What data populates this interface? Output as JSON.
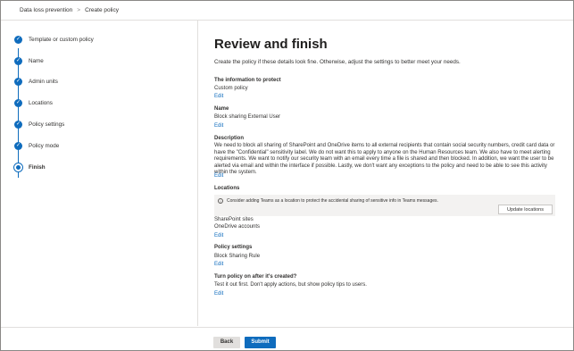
{
  "breadcrumb": {
    "items": [
      "Data loss prevention",
      "Create policy"
    ],
    "separator": ">"
  },
  "steps": [
    "Template or custom policy",
    "Name",
    "Admin units",
    "Locations",
    "Policy settings",
    "Policy mode",
    "Finish"
  ],
  "main": {
    "title": "Review and finish",
    "intro": "Create the policy if these details look fine. Otherwise, adjust the settings to better meet your needs.",
    "edit_label": "Edit",
    "info_protect": {
      "title": "The information to protect",
      "value": "Custom policy"
    },
    "name": {
      "title": "Name",
      "value": "Block sharing External User"
    },
    "description": {
      "title": "Description",
      "value": "We need to block all sharing of SharePoint and OneDrive items to all external recipients that contain social security numbers, credit card data or have the \"Confidential\" sensitivity label. We do not want this to apply to anyone on the Human Resources team. We also have to meet alerting requirements. We want to notify our security team with an email every time a file is shared and then blocked. In addition, we want the user to be alerted via email and within the interface if possible. Lastly, we don't want any exceptions to the policy and need to be able to see this activity within the system."
    },
    "locations": {
      "title": "Locations",
      "banner_text": "Consider adding Teams as a location to protect the accidental sharing of sensitive info in Teams messages.",
      "banner_button": "Update locations",
      "values": [
        "SharePoint sites",
        "OneDrive accounts"
      ]
    },
    "policy_settings": {
      "title": "Policy settings",
      "value": "Block Sharing Rule"
    },
    "turn_on": {
      "title": "Turn policy on after it's created?",
      "value": "Test it out first. Don't apply actions, but show policy tips to users."
    }
  },
  "footer": {
    "back": "Back",
    "submit": "Submit"
  },
  "colors": {
    "accent": "#0f6cbd"
  }
}
